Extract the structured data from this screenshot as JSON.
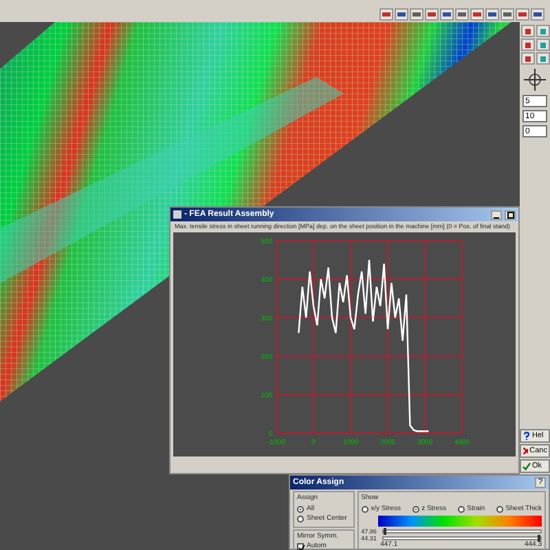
{
  "side_panel": {
    "fields": [
      {
        "value": "5"
      },
      {
        "value": "10"
      },
      {
        "value": "0"
      }
    ],
    "buttons": [
      {
        "kind": "help",
        "label": "Hel"
      },
      {
        "kind": "cancel",
        "label": "Canc"
      },
      {
        "kind": "ok",
        "label": "Ok"
      }
    ]
  },
  "result_window": {
    "title": "- FEA Result Assembly",
    "caption": "Max. tensile stress in sheet running direction [MPa] dep. on the sheet position in the machine [mm] (0 = Pos. of final stand)",
    "chart_data": {
      "type": "line",
      "xlim": [
        -1000,
        4000
      ],
      "ylim": [
        0,
        500
      ],
      "xticks": [
        -1000,
        0,
        1000,
        2000,
        3000,
        4000
      ],
      "yticks": [
        0,
        100,
        200,
        300,
        400,
        500
      ],
      "x": [
        -400,
        -300,
        -200,
        -100,
        0,
        100,
        200,
        300,
        400,
        500,
        600,
        700,
        800,
        900,
        1000,
        1100,
        1200,
        1300,
        1400,
        1500,
        1600,
        1700,
        1800,
        1900,
        2000,
        2100,
        2200,
        2300,
        2400,
        2500,
        2600,
        2700,
        2800,
        2900,
        3000,
        3100
      ],
      "grid": true,
      "series": [
        {
          "color": "#ffffff",
          "values": [
            260,
            380,
            300,
            420,
            330,
            280,
            400,
            350,
            430,
            300,
            260,
            390,
            340,
            410,
            300,
            270,
            360,
            420,
            310,
            450,
            290,
            380,
            330,
            440,
            270,
            390,
            300,
            350,
            240,
            360,
            20,
            8,
            5,
            5,
            5,
            5
          ]
        }
      ]
    }
  },
  "color_assign": {
    "title": "Color Assign",
    "help": "?",
    "assign": {
      "label": "Assign",
      "options": [
        {
          "label": "All",
          "selected": true
        },
        {
          "label": "Sheet Center",
          "selected": false
        }
      ]
    },
    "mirror": {
      "label": "Mirror Symm.",
      "option": {
        "label": "Autom",
        "checked": true
      }
    },
    "show": {
      "label": "Show",
      "options": [
        {
          "label": "x/y Stress",
          "selected": false
        },
        {
          "label": "z Stress",
          "selected": true
        },
        {
          "label": "Strain",
          "selected": false
        },
        {
          "label": "Sheet Thick",
          "selected": false
        }
      ]
    },
    "sliders": [
      {
        "reading": "47.86",
        "level": 0
      },
      {
        "reading": "44.31",
        "level": 1
      }
    ],
    "range_min": "447.1",
    "range_max": "444.3"
  }
}
